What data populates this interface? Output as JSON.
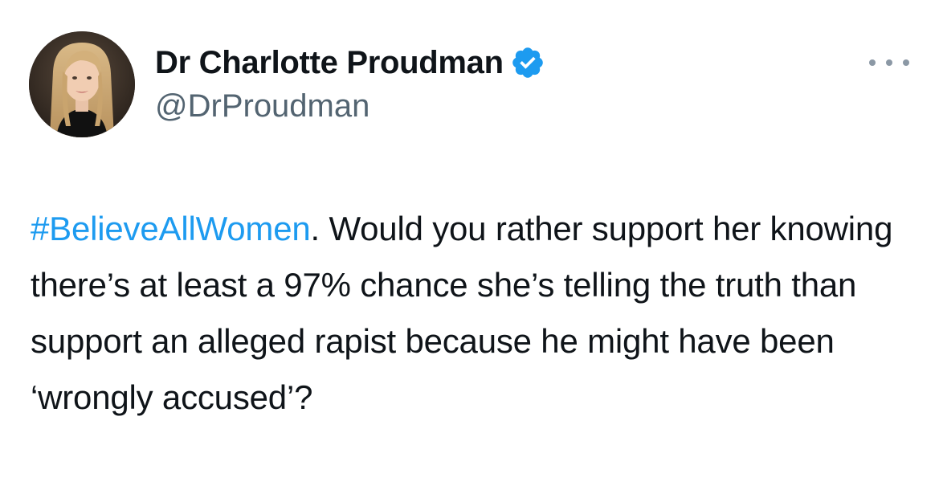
{
  "author": {
    "display_name": "Dr Charlotte Proudman",
    "handle": "@DrProudman",
    "verified": true,
    "avatar_icon": "profile-photo"
  },
  "menu": {
    "icon": "more-horizontal-icon"
  },
  "tweet": {
    "hashtag": "#BelieveAllWomen",
    "body": ". Would you rather support her knowing there’s at least a 97% chance she’s telling the truth than support an alleged rapist because he might have been ‘wrongly accused’?"
  },
  "colors": {
    "text": "#0f1419",
    "secondary": "#536471",
    "accent": "#1d9bf0"
  }
}
